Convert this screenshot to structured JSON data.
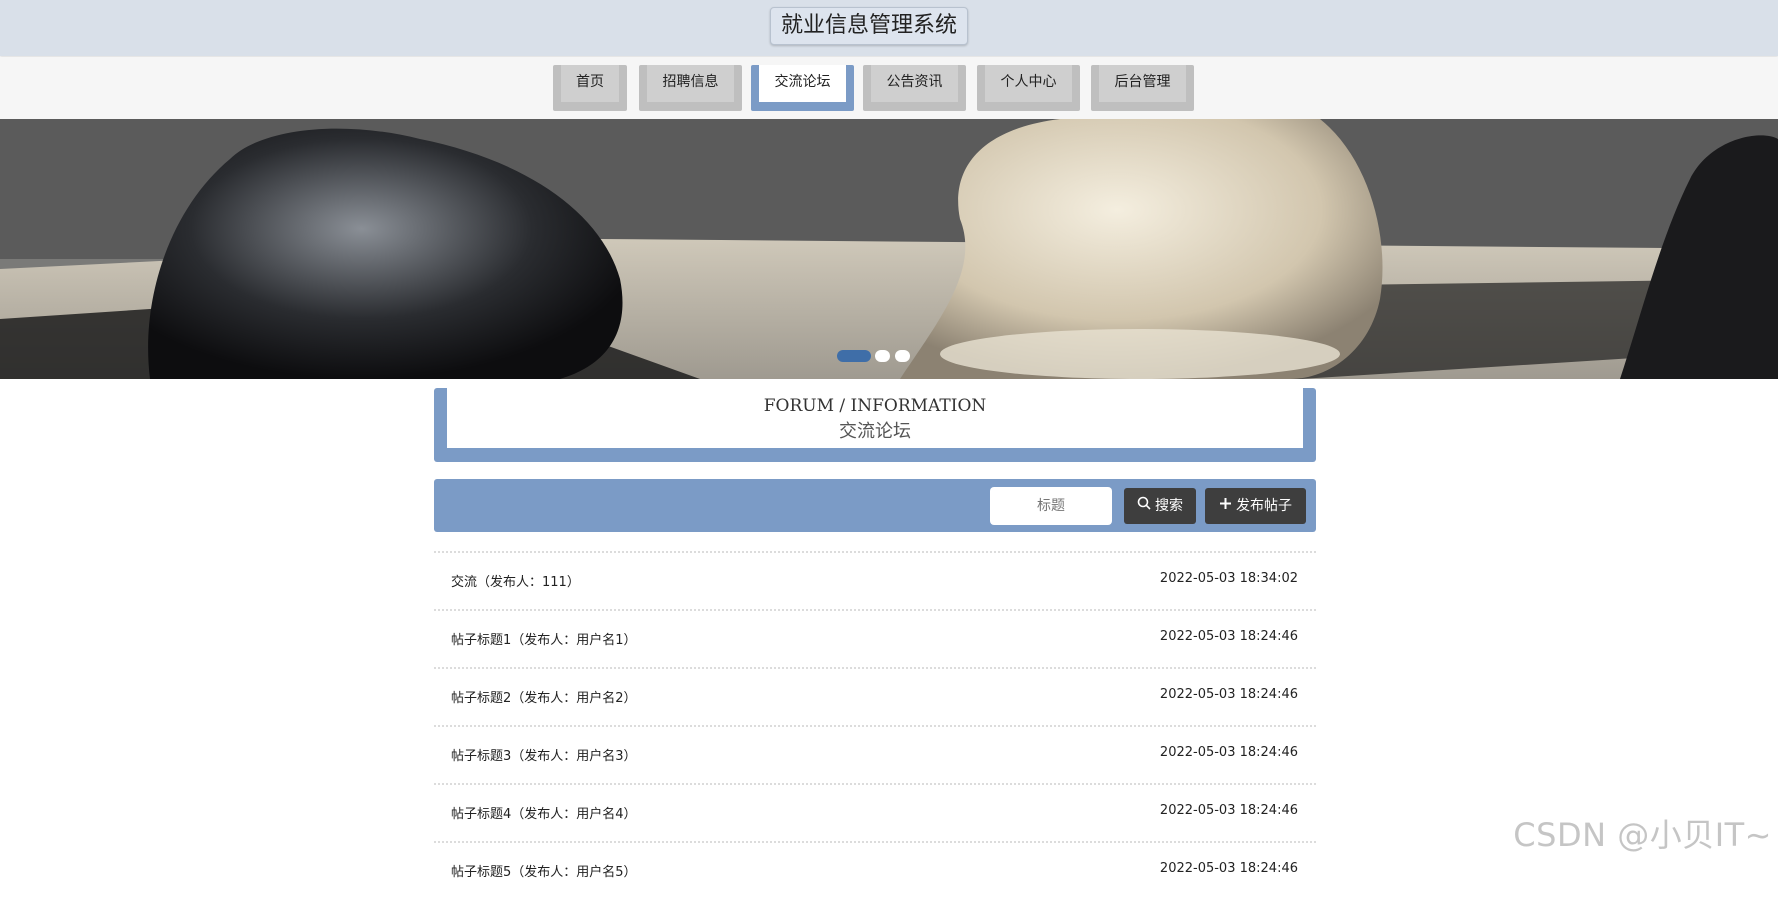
{
  "site": {
    "title": "就业信息管理系统"
  },
  "nav": {
    "items": [
      {
        "label": "首页"
      },
      {
        "label": "招聘信息"
      },
      {
        "label": "交流论坛"
      },
      {
        "label": "公告资讯"
      },
      {
        "label": "个人中心"
      },
      {
        "label": "后台管理"
      }
    ],
    "active": "交流论坛"
  },
  "banner": {
    "slides": 3,
    "current_slide": 1
  },
  "forum": {
    "title_en": "FORUM / INFORMATION",
    "title_cn": "交流论坛"
  },
  "search": {
    "placeholder": "标题",
    "search_label": "搜索",
    "post_label": "发布帖子"
  },
  "posts": [
    {
      "title": "交流（发布人：111）",
      "time": "2022-05-03 18:34:02"
    },
    {
      "title": "帖子标题1（发布人：用户名1）",
      "time": "2022-05-03 18:24:46"
    },
    {
      "title": "帖子标题2（发布人：用户名2）",
      "time": "2022-05-03 18:24:46"
    },
    {
      "title": "帖子标题3（发布人：用户名3）",
      "time": "2022-05-03 18:24:46"
    },
    {
      "title": "帖子标题4（发布人：用户名4）",
      "time": "2022-05-03 18:24:46"
    },
    {
      "title": "帖子标题5（发布人：用户名5）",
      "time": "2022-05-03 18:24:46"
    }
  ],
  "watermark": "CSDN @小贝IT~",
  "colors": {
    "accent": "#7b9bc6",
    "button": "#3e3e3e",
    "active_dot": "#3f6ea8"
  }
}
